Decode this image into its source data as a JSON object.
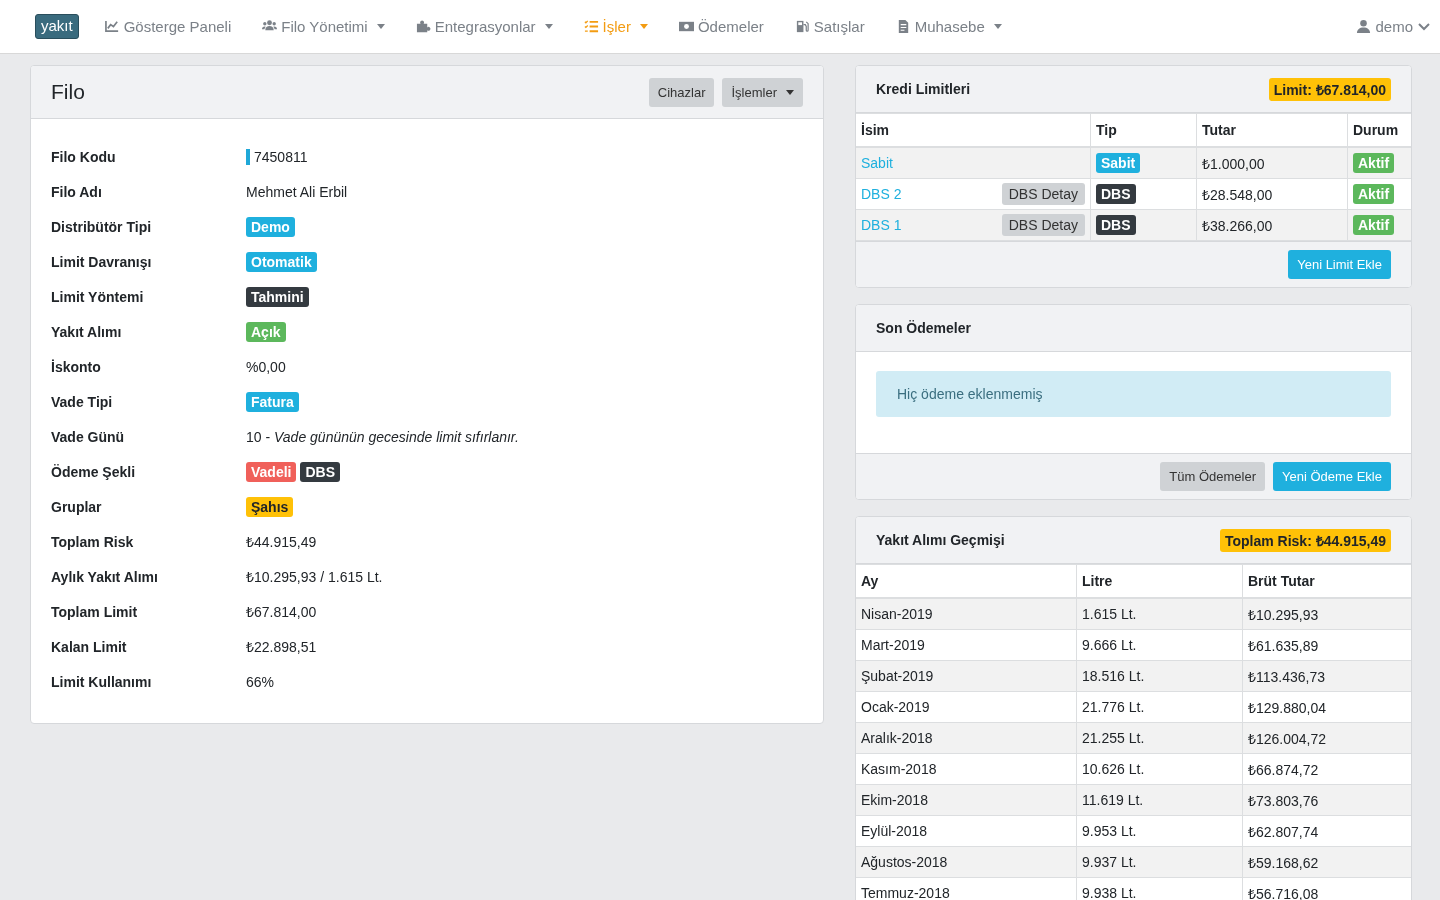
{
  "navbar": {
    "logo": "yakıt",
    "items": [
      {
        "kind": "chart",
        "label": "Gösterge Paneli",
        "dropdown": false,
        "selected": false
      },
      {
        "kind": "users",
        "label": "Filo Yönetimi",
        "dropdown": true,
        "selected": false
      },
      {
        "kind": "puzzle",
        "label": "Entegrasyonlar",
        "dropdown": true,
        "selected": false
      },
      {
        "kind": "list",
        "label": "İşler",
        "dropdown": true,
        "selected": true
      },
      {
        "kind": "money",
        "label": "Ödemeler",
        "dropdown": false,
        "selected": false
      },
      {
        "kind": "pump",
        "label": "Satışlar",
        "dropdown": false,
        "selected": false
      },
      {
        "kind": "doc",
        "label": "Muhasebe",
        "dropdown": true,
        "selected": false
      }
    ],
    "user": "demo"
  },
  "filo": {
    "title": "Filo",
    "buttons": [
      {
        "label": "Cihazlar",
        "dropdown": false
      },
      {
        "label": "İşlemler",
        "dropdown": true
      }
    ],
    "rows": [
      {
        "label": "Filo Kodu",
        "kind": "code",
        "value": "7450811"
      },
      {
        "label": "Filo Adı",
        "kind": "text",
        "value": "Mehmet Ali Erbil"
      },
      {
        "label": "Distribütör Tipi",
        "kind": "badges",
        "badges": [
          {
            "text": "Demo",
            "kind": "info"
          }
        ]
      },
      {
        "label": "Limit Davranışı",
        "kind": "badges",
        "badges": [
          {
            "text": "Otomatik",
            "kind": "info"
          }
        ]
      },
      {
        "label": "Limit Yöntemi",
        "kind": "badges",
        "badges": [
          {
            "text": "Tahmini",
            "kind": "dark"
          }
        ]
      },
      {
        "label": "Yakıt Alımı",
        "kind": "badges",
        "badges": [
          {
            "text": "Açık",
            "kind": "success"
          }
        ]
      },
      {
        "label": "İskonto",
        "kind": "text",
        "value": "%0,00"
      },
      {
        "label": "Vade Tipi",
        "kind": "badges",
        "badges": [
          {
            "text": "Fatura",
            "kind": "info"
          }
        ]
      },
      {
        "label": "Vade Günü",
        "kind": "text",
        "value": "10 - *Vade gününün gecesinde limit sıfırlanır.*"
      },
      {
        "label": "Ödeme Şekli",
        "kind": "badges",
        "badges": [
          {
            "text": "Vadeli",
            "kind": "danger"
          },
          {
            "text": "DBS",
            "kind": "dark"
          }
        ]
      },
      {
        "label": "Gruplar",
        "kind": "badges",
        "badges": [
          {
            "text": "Şahıs",
            "kind": "warning"
          }
        ]
      },
      {
        "label": "Toplam Risk",
        "kind": "text",
        "value": "₺44.915,49"
      },
      {
        "label": "Aylık Yakıt Alımı",
        "kind": "text",
        "value": "₺10.295,93 / 1.615 Lt."
      },
      {
        "label": "Toplam Limit",
        "kind": "text",
        "value": "₺67.814,00"
      },
      {
        "label": "Kalan Limit",
        "kind": "text",
        "value": "₺22.898,51"
      },
      {
        "label": "Limit Kullanımı",
        "kind": "text",
        "value": "66%"
      }
    ]
  },
  "kredi": {
    "title": "Kredi Limitleri",
    "badge": "Limit: ₺67.814,00",
    "columns": [
      "İsim",
      "Tip",
      "Tutar",
      "Durum"
    ],
    "rows": [
      {
        "name": "Sabit",
        "type": {
          "text": "Sabit",
          "kind": "info"
        },
        "amount": "₺1.000,00",
        "status": {
          "text": "Aktif",
          "kind": "success"
        }
      },
      {
        "name": "DBS 2",
        "detail": "DBS Detay",
        "type": {
          "text": "DBS",
          "kind": "dark"
        },
        "amount": "₺28.548,00",
        "status": {
          "text": "Aktif",
          "kind": "success"
        }
      },
      {
        "name": "DBS 1",
        "detail": "DBS Detay",
        "type": {
          "text": "DBS",
          "kind": "dark"
        },
        "amount": "₺38.266,00",
        "status": {
          "text": "Aktif",
          "kind": "success"
        }
      }
    ],
    "button": "Yeni Limit Ekle"
  },
  "odemeler": {
    "title": "Son Ödemeler",
    "alert": "Hiç ödeme eklenmemiş",
    "buttons": [
      {
        "label": "Tüm Ödemeler",
        "kind": "secondary"
      },
      {
        "label": "Yeni Ödeme Ekle",
        "kind": "info"
      }
    ]
  },
  "gecmis": {
    "title": "Yakıt Alımı Geçmişi",
    "badge": "Toplam Risk: ₺44.915,49",
    "columns": [
      "Ay",
      "Litre",
      "Brüt Tutar"
    ],
    "rows": [
      [
        "Nisan-2019",
        "1.615 Lt.",
        "₺10.295,93"
      ],
      [
        "Mart-2019",
        "9.666 Lt.",
        "₺61.635,89"
      ],
      [
        "Şubat-2019",
        "18.516 Lt.",
        "₺113.436,73"
      ],
      [
        "Ocak-2019",
        "21.776 Lt.",
        "₺129.880,04"
      ],
      [
        "Aralık-2018",
        "21.255 Lt.",
        "₺126.004,72"
      ],
      [
        "Kasım-2018",
        "10.626 Lt.",
        "₺66.874,72"
      ],
      [
        "Ekim-2018",
        "11.619 Lt.",
        "₺73.803,76"
      ],
      [
        "Eylül-2018",
        "9.953 Lt.",
        "₺62.807,74"
      ],
      [
        "Ağustos-2018",
        "9.937 Lt.",
        "₺59.168,62"
      ],
      [
        "Temmuz-2018",
        "9.938 Lt.",
        "₺56.716,08"
      ]
    ]
  }
}
